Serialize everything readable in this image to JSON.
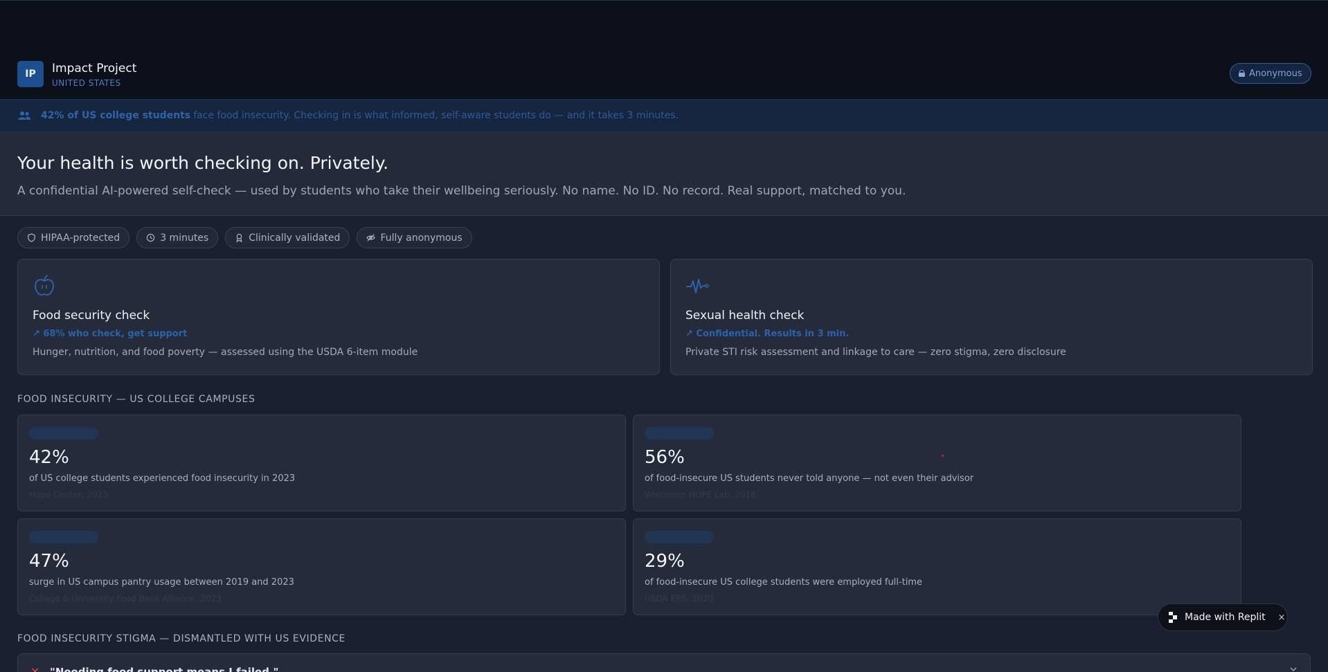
{
  "header": {
    "logo_text": "IP",
    "brand_name": "Impact Project",
    "brand_sub": "UNITED STATES",
    "anonymous_label": "Anonymous"
  },
  "banner": {
    "strong": "42% of US college students",
    "rest": "face food insecurity. Checking in is what informed, self-aware students do — and it takes 3 minutes."
  },
  "hero": {
    "title": "Your health is worth checking on. Privately.",
    "subtitle": "A confidential AI-powered self-check — used by students who take their wellbeing seriously. No name. No ID. No record. Real support, matched to you."
  },
  "pills": [
    {
      "label": "HIPAA-protected",
      "icon": "shield-icon"
    },
    {
      "label": "3 minutes",
      "icon": "clock-icon"
    },
    {
      "label": "Clinically validated",
      "icon": "award-icon"
    },
    {
      "label": "Fully anonymous",
      "icon": "eye-off-icon"
    }
  ],
  "checks": [
    {
      "title": "Food security check",
      "tag": "↗ 68% who check, get support",
      "desc": "Hunger, nutrition, and food poverty — assessed using the USDA 6-item module",
      "icon": "apple-icon"
    },
    {
      "title": "Sexual health check",
      "tag": "↗ Confidential. Results in 3 min.",
      "desc": "Private STI risk assessment and linkage to care — zero stigma, zero disclosure",
      "icon": "pulse-icon"
    }
  ],
  "stats_section_title": "FOOD INSECURITY — US COLLEGE CAMPUSES",
  "stats": [
    {
      "value": "42%",
      "label": "of US college students experienced food insecurity in 2023",
      "source": "Hope Center, 2023"
    },
    {
      "value": "56%",
      "label": "of food-insecure US students never told anyone — not even their advisor",
      "source": "Wisconsin HOPE Lab, 2018"
    },
    {
      "value": "47%",
      "label": "surge in US campus pantry usage between 2019 and 2023",
      "source": "College & University Food Bank Alliance, 2023"
    },
    {
      "value": "29%",
      "label": "of food-insecure US college students were employed full-time",
      "source": "USDA ERS, 2020"
    }
  ],
  "stigma_section_title": "FOOD INSECURITY STIGMA — DISMANTLED WITH US EVIDENCE",
  "stigma_items": [
    {
      "quote": "\"Needing food support means I failed.\""
    }
  ],
  "replit": {
    "label": "Made with Replit",
    "close": "×"
  },
  "colors": {
    "accent": "#2a63aa",
    "background": "#1b2030",
    "card": "#262b3c"
  }
}
